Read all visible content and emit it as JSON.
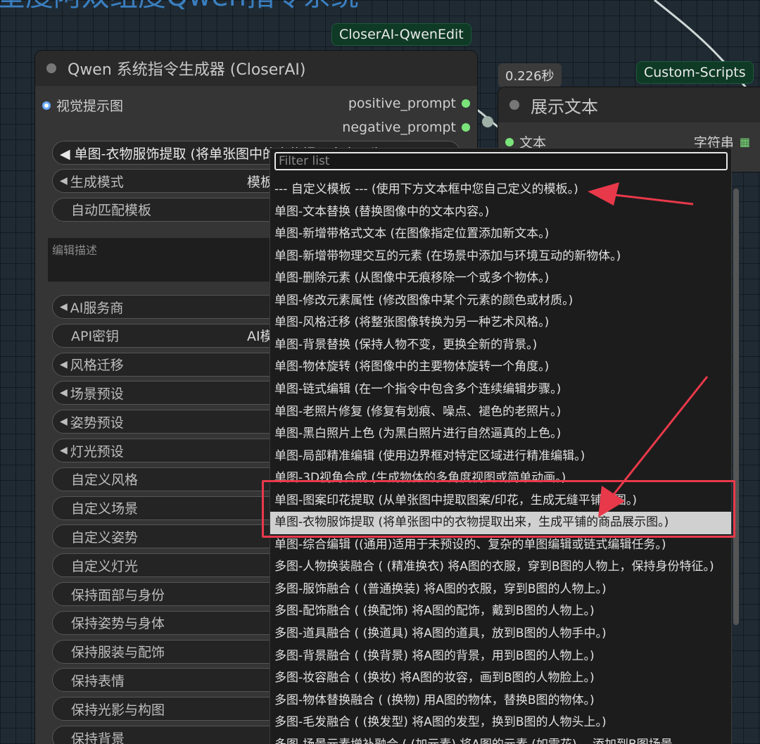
{
  "canvas_title": "呈度阿双组度Qwen指令系统",
  "badges": {
    "node_group": "CloserAI-QwenEdit",
    "custom_scripts": "Custom-Scripts",
    "timing": "0.226秒"
  },
  "main_node": {
    "title": "Qwen 系统指令生成器 (CloserAI)",
    "input_label": "视觉提示图",
    "outputs": [
      "positive_prompt",
      "negative_prompt"
    ],
    "first_widget": "◀ 单图-衣物服饰提取 (将单张图中的衣物提取出来，生",
    "widgets": [
      {
        "label": "生成模式",
        "value": "模板",
        "arrow": true
      },
      {
        "label": "自动匹配模板",
        "value": "",
        "arrow": false
      }
    ],
    "textarea_placeholder": "编辑描述",
    "widgets2": [
      {
        "label": "AI服务商",
        "value": "",
        "arrow": true
      },
      {
        "label": "API密钥",
        "value": "AI模",
        "arrow": false
      },
      {
        "label": "风格迁移",
        "value": "",
        "arrow": true
      },
      {
        "label": "场景预设",
        "value": "",
        "arrow": true
      },
      {
        "label": "姿势预设",
        "value": "",
        "arrow": true
      },
      {
        "label": "灯光预设",
        "value": "",
        "arrow": true
      },
      {
        "label": "自定义风格",
        "value": "",
        "arrow": false
      },
      {
        "label": "自定义场景",
        "value": "",
        "arrow": false
      },
      {
        "label": "自定义姿势",
        "value": "",
        "arrow": false
      },
      {
        "label": "自定义灯光",
        "value": "",
        "arrow": false
      },
      {
        "label": "保持面部与身份",
        "value": "",
        "arrow": false
      },
      {
        "label": "保持姿势与身体",
        "value": "",
        "arrow": false
      },
      {
        "label": "保持服装与配饰",
        "value": "",
        "arrow": false
      },
      {
        "label": "保持表情",
        "value": "",
        "arrow": false
      },
      {
        "label": "保持光影与构图",
        "value": "",
        "arrow": false
      },
      {
        "label": "保持背景",
        "value": "",
        "arrow": false
      }
    ]
  },
  "text_node": {
    "title": "展示文本",
    "input_label": "文本",
    "output_label": "字符串"
  },
  "dropdown": {
    "filter_placeholder": "Filter list",
    "items": [
      "--- 自定义模板 --- (使用下方文本框中您自己定义的模板。)",
      "单图-文本替换 (替换图像中的文本内容。)",
      "单图-新增带格式文本 (在图像指定位置添加新文本。)",
      "单图-新增带物理交互的元素 (在场景中添加与环境互动的新物体。)",
      "单图-删除元素 (从图像中无痕移除一个或多个物体。)",
      "单图-修改元素属性 (修改图像中某个元素的颜色或材质。)",
      "单图-风格迁移 (将整张图像转换为另一种艺术风格。)",
      "单图-背景替换 (保持人物不变，更换全新的背景。)",
      "单图-物体旋转 (将图像中的主要物体旋转一个角度。)",
      "单图-链式编辑 (在一个指令中包含多个连续编辑步骤。)",
      "单图-老照片修复 (修复有划痕、噪点、褪色的老照片。)",
      "单图-黑白照片上色 (为黑白照片进行自然逼真的上色。)",
      "单图-局部精准编辑 (使用边界框对特定区域进行精准编辑。)",
      "单图-3D视角合成 (生成物体的多角度视图或简单动画。)",
      "单图-图案印花提取 (从单张图中提取图案/印花，生成无缝平铺的图。)",
      "单图-衣物服饰提取 (将单张图中的衣物提取出来，生成平铺的商品展示图。)",
      "单图-综合编辑 ((通用)适用于未预设的、复杂的单图编辑或链式编辑任务。)",
      "多图-人物换装融合 ( (精准换衣) 将A图的衣服，穿到B图的人物上，保持身份特征。)",
      "多图-服饰融合 ( (普通换装) 将A图的衣服，穿到B图的人物上。)",
      "多图-配饰融合 ( (换配饰) 将A图的配饰，戴到B图的人物上。)",
      "多图-道具融合 ( (换道具) 将A图的道具，放到B图的人物手中。)",
      "多图-背景融合 ( (换背景) 将A图的背景，用到B图的人物上。)",
      "多图-妆容融合 ( (换妆) 将A图的妆容，画到B图的人物脸上。)",
      "多图-物体替换融合 ( (换物) 用A图的物体，替换B图的物体。)",
      "多图-毛发融合 ( (换发型) 将A图的发型，换到B图的人物头上。)",
      "多图-场景元素增补融合 ( (加元素) 将A图的元素 (如雪花) ，添加到B图场景"
    ],
    "selected_index": 15
  },
  "colors": {
    "annotation_red": "#e8394a",
    "output_green": "#7be37b",
    "input_blue": "#6aa8ff"
  }
}
